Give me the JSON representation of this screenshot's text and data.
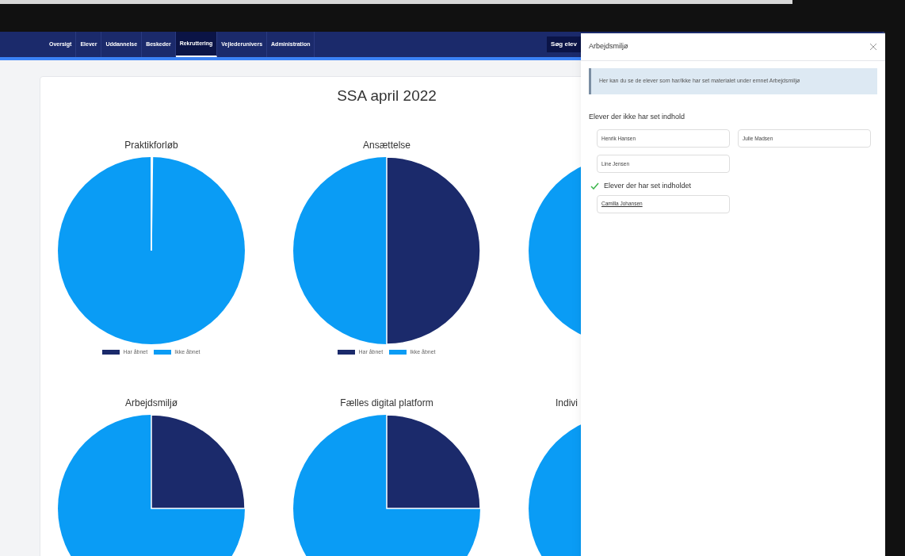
{
  "nav": {
    "items": [
      {
        "label": "Oversigt",
        "selected": false
      },
      {
        "label": "Elever",
        "selected": false
      },
      {
        "label": "Uddannelse",
        "selected": false
      },
      {
        "label": "Beskeder",
        "selected": false
      },
      {
        "label": "Rekruttering",
        "selected": true
      },
      {
        "label": "Vejlederunivers",
        "selected": false
      },
      {
        "label": "Administration",
        "selected": false
      }
    ],
    "search_button": "Søg elev"
  },
  "page": {
    "title": "SSA april 2022",
    "charts": [
      {
        "kind": "pie",
        "title": "Praktikforløb",
        "legend": [
          {
            "label": "Har åbnet",
            "color": "#1b2a6b"
          },
          {
            "label": "Ikke åbnet",
            "color": "#0a9cf5"
          }
        ]
      },
      {
        "kind": "pie",
        "title": "Ansættelse",
        "legend": [
          {
            "label": "Har åbnet",
            "color": "#1b2a6b"
          },
          {
            "label": "Ikke åbnet",
            "color": "#0a9cf5"
          }
        ]
      },
      {
        "kind": "pie"
      },
      {
        "kind": "pie",
        "title": "Arbejdsmiljø"
      },
      {
        "kind": "pie",
        "title": "Fælles digital platform"
      },
      {
        "kind": "pie",
        "title": "Indivi",
        "cut_off": true
      }
    ]
  },
  "panel": {
    "title": "Arbejdsmiljø",
    "info": "Her kan du se de elever som har/ikke har set materialet under emnet Arbejdsmiljø",
    "not_seen": {
      "heading": "Elever der ikke har set indhold",
      "students": [
        "Henrik Hansen",
        "Julie Madsen",
        "Line Jensen"
      ]
    },
    "seen": {
      "heading": "Elever der har set indholdet",
      "students": [
        "Camilla Johansen"
      ]
    }
  }
}
